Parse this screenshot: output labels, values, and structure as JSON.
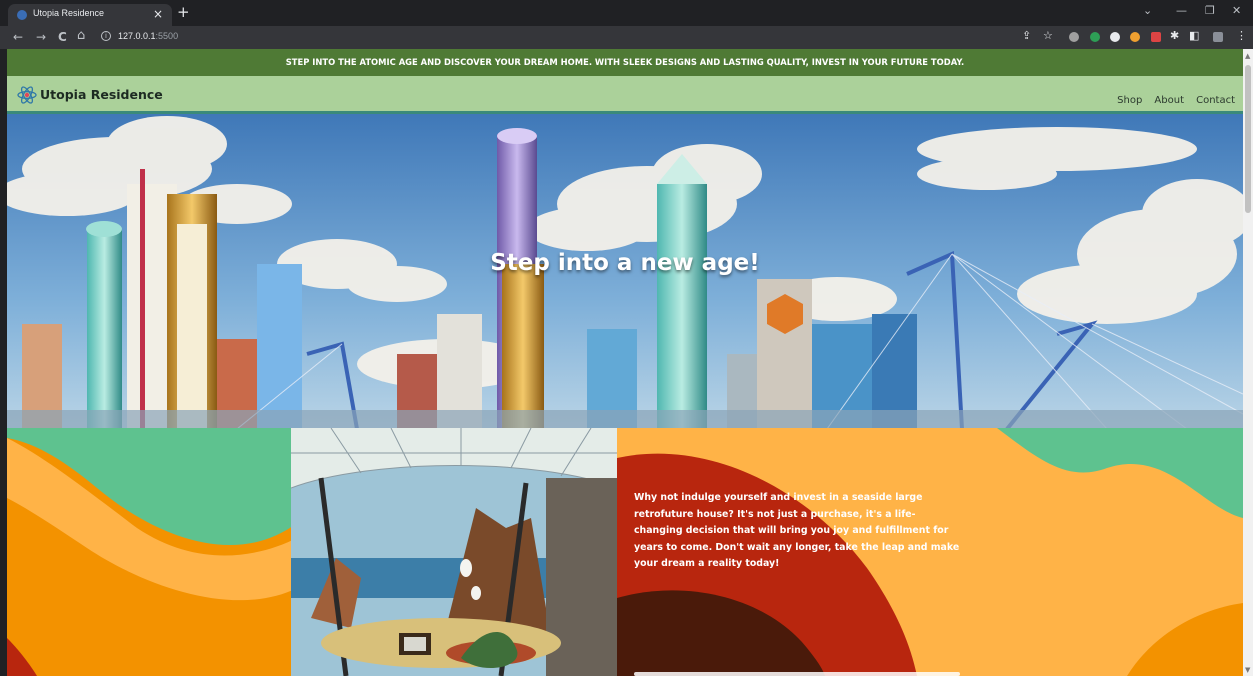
{
  "browser": {
    "tab_title": "Utopia Residence",
    "tab_close_icon": "×",
    "new_tab_icon": "+",
    "url_host": "127.0.0.1",
    "url_port": ":5500",
    "win_minimize": "—",
    "win_restore": "❐",
    "win_close": "✕",
    "tab_list_icon": "⌄",
    "nav_back": "←",
    "nav_forward": "→",
    "nav_reload": "C",
    "nav_home": "⌂",
    "info_icon": "i",
    "share_icon": "⇪",
    "star_icon": "☆",
    "menu_icon": "⋮",
    "puzzle_icon": "✱",
    "sidepanel_icon": "◧"
  },
  "page": {
    "promo_banner": "STEP INTO THE ATOMIC AGE AND DISCOVER YOUR DREAM HOME. WITH SLEEK DESIGNS AND LASTING QUALITY, INVEST IN YOUR FUTURE TODAY.",
    "brand": "Utopia Residence",
    "nav": [
      "Shop",
      "About",
      "Contact"
    ],
    "hero_title": "Step into a new age!",
    "pitch": "Why not indulge yourself and invest in a seaside large retrofuture house? It's not just a purchase, it's a life-changing decision that will bring you joy and fulfillment for years to come. Don't wait any longer, take the leap and make your dream a reality today!"
  },
  "colors": {
    "promo_bg": "#4f7a35",
    "navbar_bg": "#abd19a",
    "wave_green": "#5ec28f",
    "wave_orange": "#ffb347",
    "wave_deep_orange": "#f39200",
    "wave_red": "#b8260e",
    "wave_brown": "#4a1a0a"
  }
}
